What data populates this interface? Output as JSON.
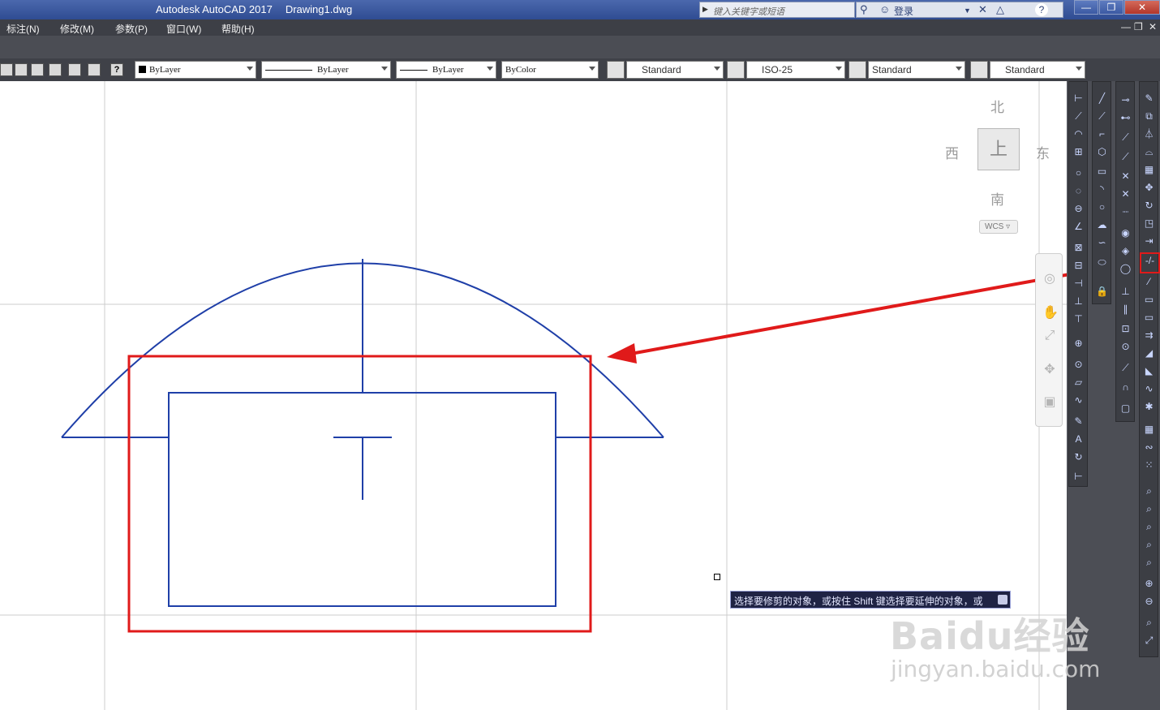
{
  "window": {
    "app_title": "Autodesk AutoCAD 2017",
    "doc_title": "Drawing1.dwg",
    "search_placeholder": "键入关键字或短语",
    "login_label": "登录",
    "help_icon": "?"
  },
  "menu": {
    "items": [
      "标注(N)",
      "修改(M)",
      "参数(P)",
      "窗口(W)",
      "帮助(H)"
    ]
  },
  "properties_toolbar": {
    "layer_combo": "ByLayer",
    "linetype_combo": "ByLayer",
    "lineweight_combo": "ByLayer",
    "color_combo": "ByColor",
    "text_style": "Standard",
    "dim_style": "ISO-25",
    "table_style": "Standard",
    "multileader_style": "Standard"
  },
  "viewcube": {
    "north": "北",
    "south": "南",
    "east": "东",
    "west": "西",
    "face": "上",
    "wcs": "WCS"
  },
  "tooltip": {
    "text": "选择要修剪的对象，或按住 Shift 键选择要延伸的对象，或"
  },
  "watermark": {
    "main": "Baidu经验",
    "sub": "jingyan.baidu.com"
  },
  "colors": {
    "geometry": "#1f3fa8",
    "highlight": "#e01a1a",
    "grid": "#cccccc"
  }
}
